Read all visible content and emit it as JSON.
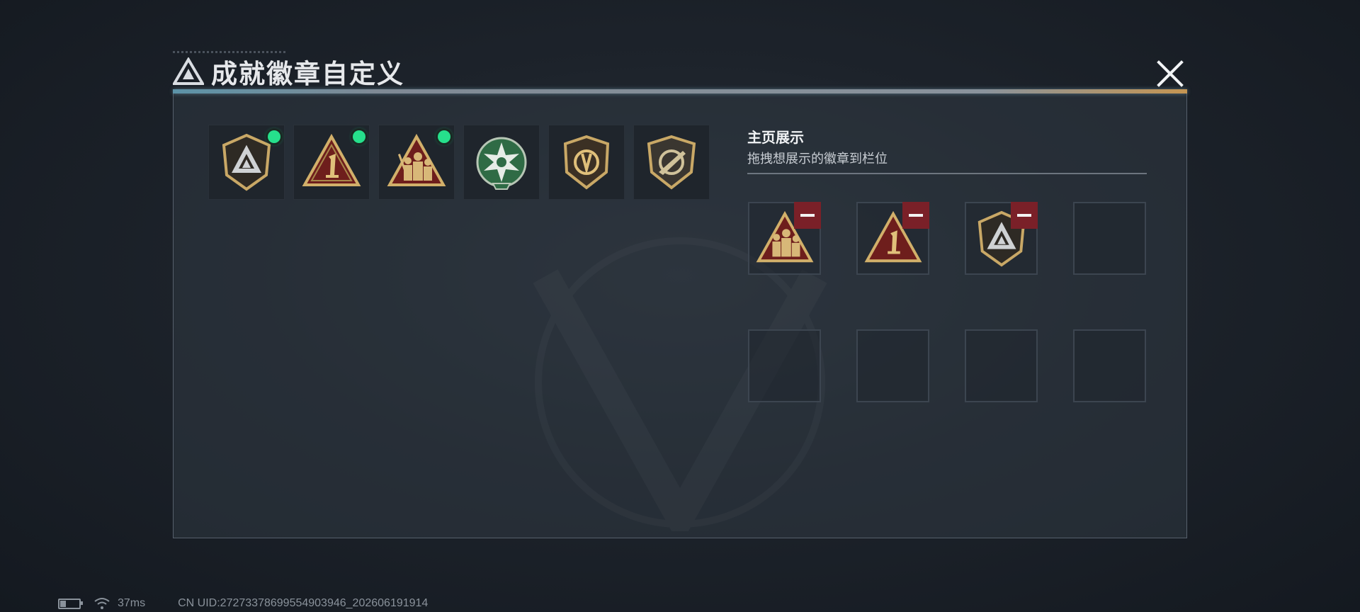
{
  "header": {
    "title": "成就徽章自定义"
  },
  "badges": [
    {
      "icon": "shield-triangle-badge-icon",
      "active": true
    },
    {
      "icon": "number-one-triangle-badge-icon",
      "active": true
    },
    {
      "icon": "soldiers-triangle-badge-icon",
      "active": true
    },
    {
      "icon": "green-star-badge-icon",
      "active": false
    },
    {
      "icon": "shield-emblem-badge-icon",
      "active": false
    },
    {
      "icon": "knife-shield-badge-icon",
      "active": false
    }
  ],
  "showcase": {
    "title": "主页展示",
    "subtitle": "拖拽想展示的徽章到栏位",
    "slots": [
      {
        "icon": "soldiers-triangle-badge-icon",
        "filled": true
      },
      {
        "icon": "number-one-triangle-badge-icon",
        "filled": true
      },
      {
        "icon": "shield-triangle-badge-icon",
        "filled": true
      },
      {
        "filled": false
      },
      {
        "filled": false
      },
      {
        "filled": false
      },
      {
        "filled": false
      },
      {
        "filled": false
      }
    ]
  },
  "status": {
    "battery_level": 0.35,
    "ping": "37ms",
    "uid": "CN UID:2727337869955490394­6_202606191914"
  },
  "colors": {
    "active_dot": "#26e08c",
    "remove_button": "#7a2028",
    "badge_gold": "#c9a866"
  }
}
